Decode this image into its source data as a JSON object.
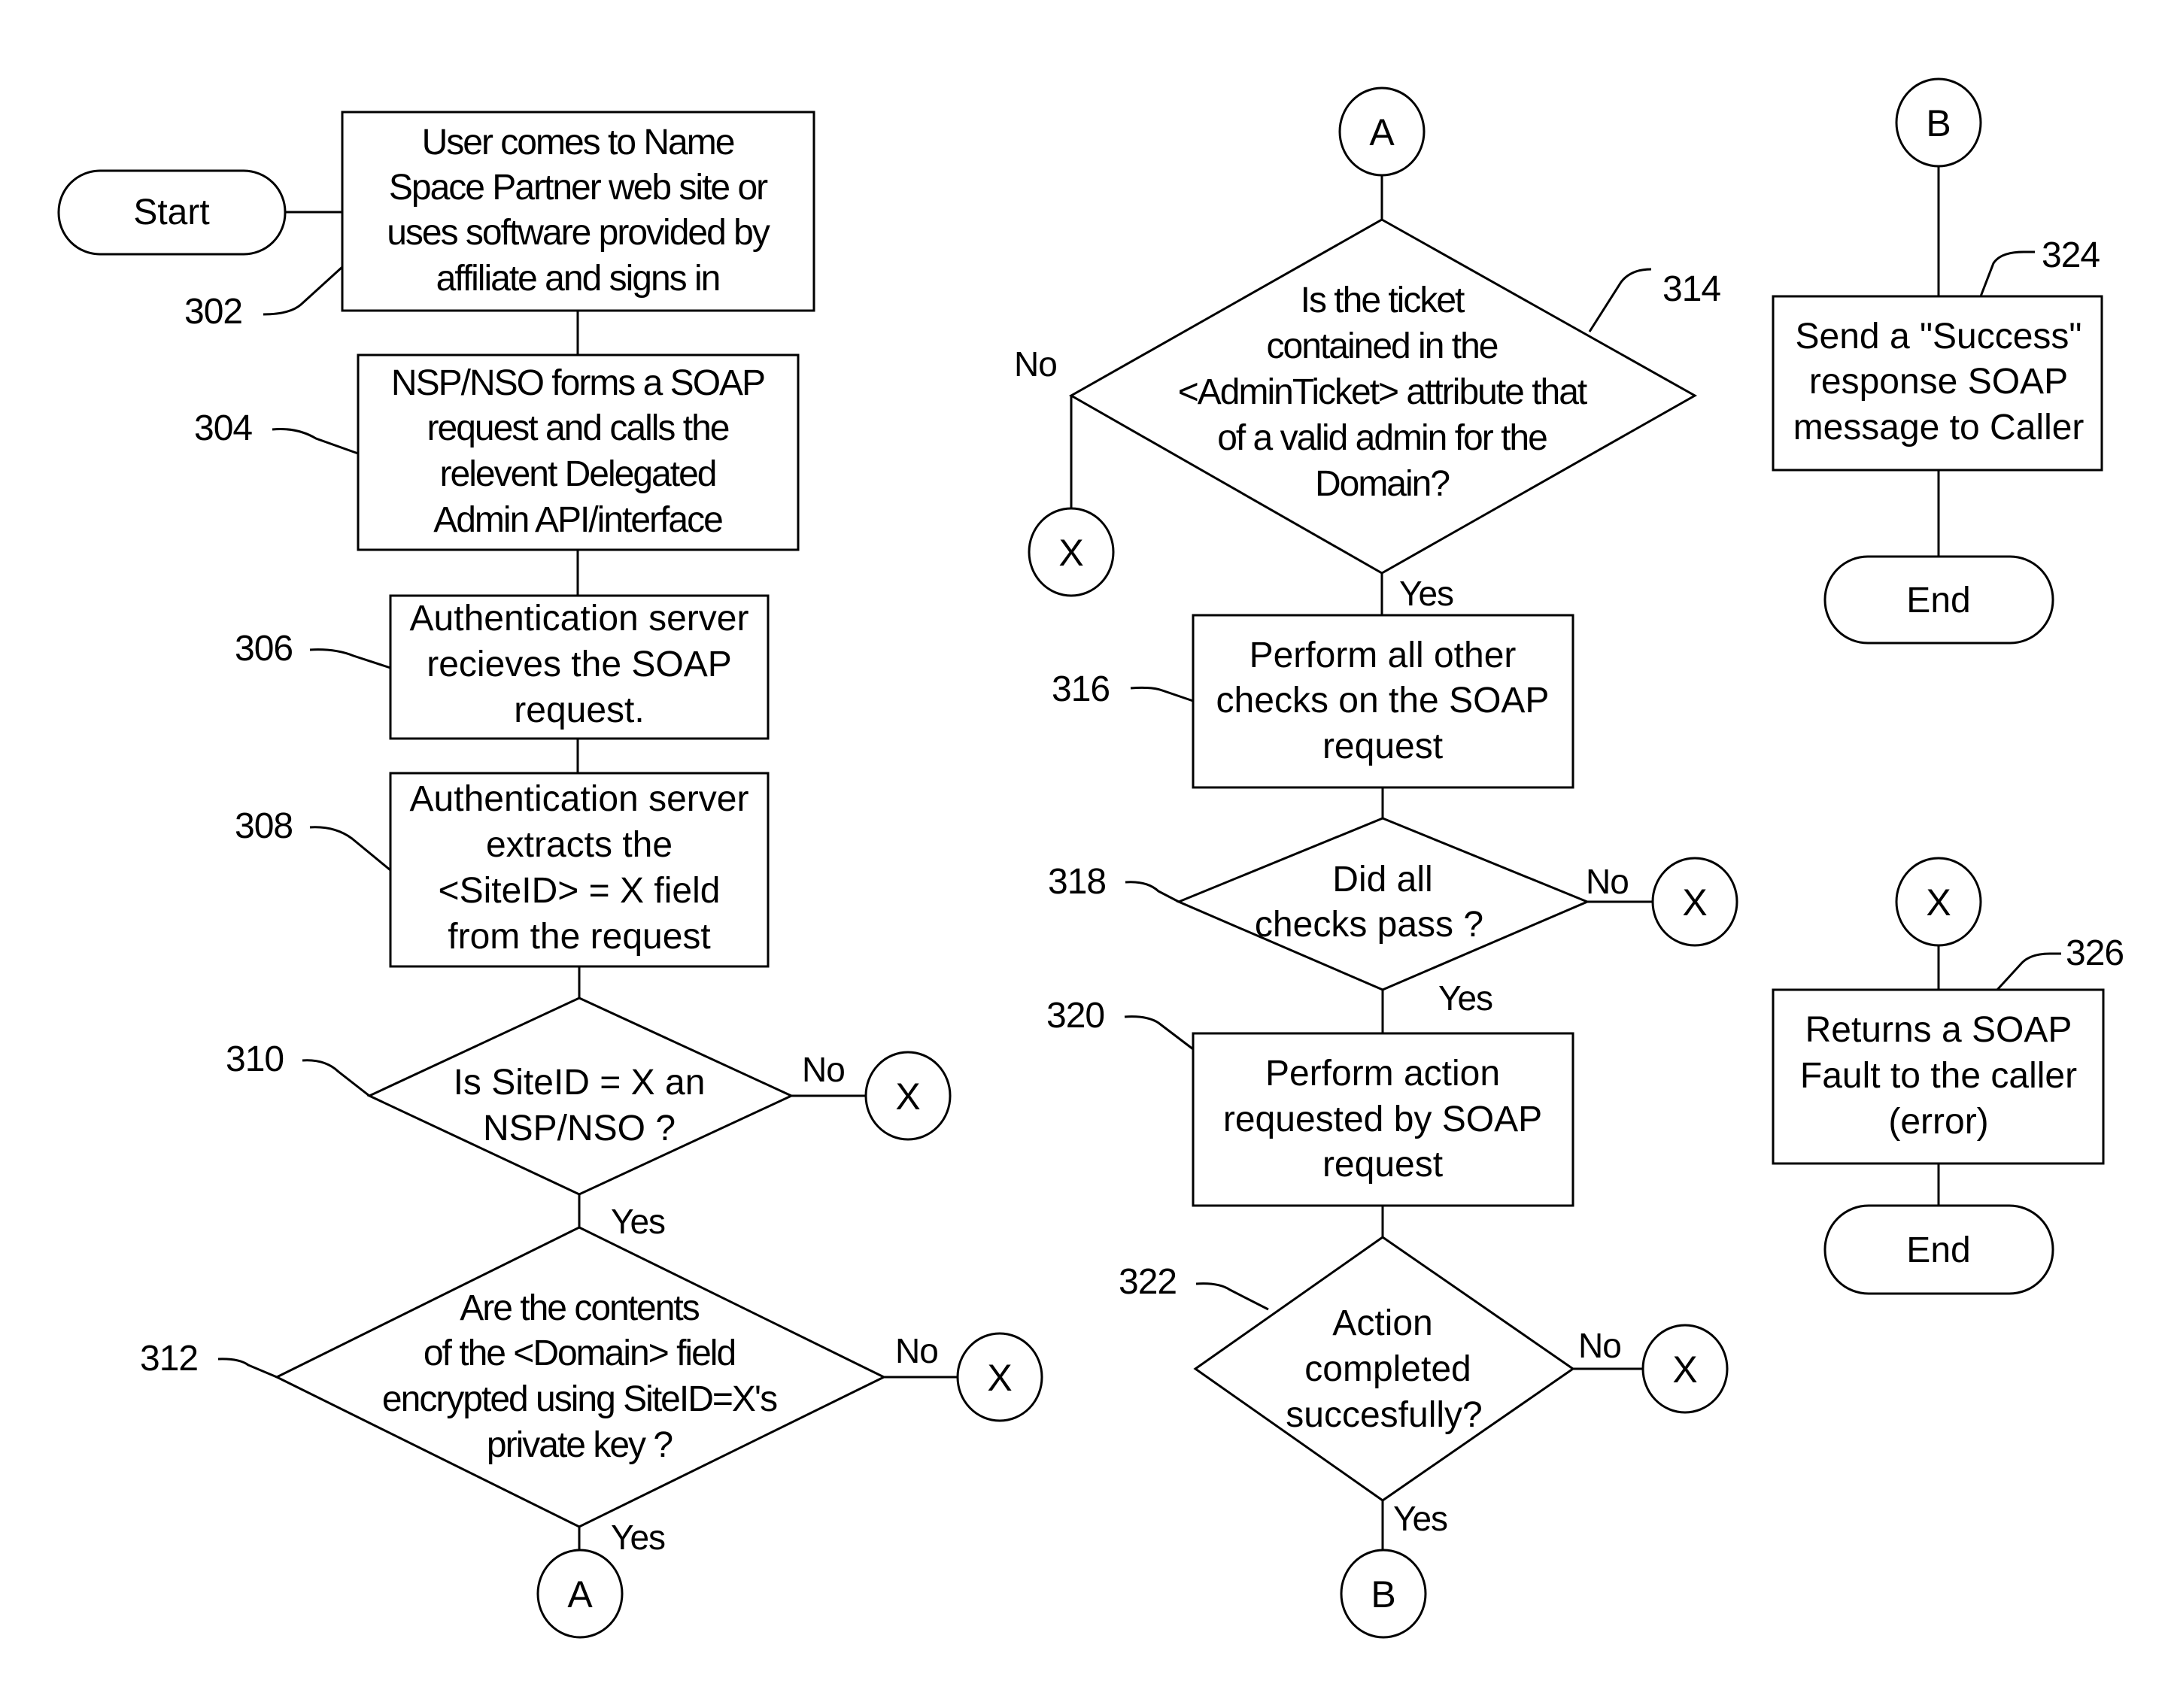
{
  "diagram": {
    "terminals": {
      "start": "Start",
      "end_success": "End",
      "end_error": "End"
    },
    "steps": {
      "s302": {
        "ref": "302",
        "lines": [
          "User comes to Name",
          "Space Partner web site or",
          "uses software provided by",
          "affiliate and signs in"
        ]
      },
      "s304": {
        "ref": "304",
        "lines": [
          "NSP/NSO forms a SOAP",
          "request and calls the",
          "relevent Delegated",
          "Admin API/interface"
        ]
      },
      "s306": {
        "ref": "306",
        "lines": [
          "Authentication server",
          "recieves the SOAP",
          "request."
        ]
      },
      "s308": {
        "ref": "308",
        "lines": [
          "Authentication server",
          "extracts  the",
          "<SiteID> = X field",
          "from the request"
        ]
      },
      "s310": {
        "ref": "310",
        "lines": [
          "Is SiteID = X an",
          "NSP/NSO ?"
        ]
      },
      "s312": {
        "ref": "312",
        "lines": [
          "Are the contents",
          "of the <Domain> field",
          "encrypted using SiteID=X's",
          "private key ?"
        ]
      },
      "s314": {
        "ref": "314",
        "lines": [
          "Is the ticket",
          "contained in the",
          "<AdminTicket> attribute that",
          "of a valid admin for the",
          "Domain?"
        ]
      },
      "s316": {
        "ref": "316",
        "lines": [
          "Perform all other",
          "checks on the SOAP",
          "request"
        ]
      },
      "s318": {
        "ref": "318",
        "lines": [
          "Did all",
          "checks pass ?"
        ]
      },
      "s320": {
        "ref": "320",
        "lines": [
          "Perform action",
          "requested by SOAP",
          "request"
        ]
      },
      "s322": {
        "ref": "322",
        "lines": [
          "Action",
          "completed",
          "succesfully?"
        ]
      },
      "s324": {
        "ref": "324",
        "lines": [
          "Send a \"Success\"",
          "response SOAP",
          "message to Caller"
        ]
      },
      "s326": {
        "ref": "326",
        "lines": [
          "Returns a SOAP",
          "Fault to the caller",
          "(error)"
        ]
      }
    },
    "branch_labels": {
      "yes": "Yes",
      "no": "No"
    },
    "connectors": {
      "a": "A",
      "b": "B",
      "x": "X"
    }
  }
}
